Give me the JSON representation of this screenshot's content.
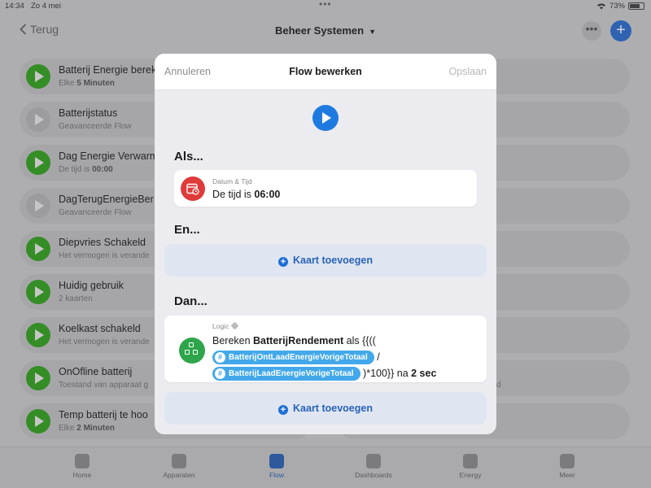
{
  "statusbar": {
    "time": "14:34",
    "date": "Zo 4 mei",
    "battery": "73%"
  },
  "nav": {
    "back_label": "Terug",
    "title": "Beheer Systemen"
  },
  "flows": [
    {
      "title": "Batterij Energie berek",
      "subtitle_pre": "Elke ",
      "subtitle_bold": "5 Minuten",
      "enabled": true
    },
    {
      "title": "Batterijstatus",
      "subtitle_pre": "Geavanceerde Flow",
      "subtitle_bold": "",
      "enabled": false
    },
    {
      "title": "Dag Energie Verwarm",
      "subtitle_pre": "De tijd is ",
      "subtitle_bold": "00:00",
      "enabled": true
    },
    {
      "title": "DagTerugEnergieBer",
      "subtitle_pre": "Geavanceerde Flow",
      "subtitle_bold": "",
      "enabled": false
    },
    {
      "title": "Diepvries Schakeld",
      "subtitle_pre": "Het vermogen is verande",
      "subtitle_bold": "",
      "enabled": true
    },
    {
      "title": "Huidig gebruik",
      "subtitle_pre": "2 kaarten",
      "subtitle_bold": "",
      "enabled": true
    },
    {
      "title": "Koelkast schakeld",
      "subtitle_pre": "Het vermogen is verande",
      "subtitle_bold": "",
      "enabled": true
    },
    {
      "title": "OnOfline batterij",
      "subtitle_pre": "Toestand van apparaat g",
      "subtitle_bold": "",
      "enabled": true
    },
    {
      "title": "Temp  batterij te hoo",
      "subtitle_pre": "Elke ",
      "subtitle_bold": "2 Minuten",
      "enabled": true
    }
  ],
  "right_rows": {
    "row8_fragment": "d"
  },
  "tabs": [
    {
      "label": "Home",
      "icon": "home-icon"
    },
    {
      "label": "Apparaten",
      "icon": "grid-icon"
    },
    {
      "label": "Flow",
      "icon": "shuffle-icon",
      "active": true
    },
    {
      "label": "Dashboards",
      "icon": "dashboard-icon"
    },
    {
      "label": "Energy",
      "icon": "leaf-icon"
    },
    {
      "label": "Meer",
      "icon": "ellipsis-icon"
    }
  ],
  "modal": {
    "cancel": "Annuleren",
    "title": "Flow bewerken",
    "save": "Opslaan",
    "when_heading": "Als...",
    "when_card": {
      "label": "Datum & Tijd",
      "text_pre": "De tijd is ",
      "text_bold": "06:00"
    },
    "and_heading": "En...",
    "add_card": "Kaart toevoegen",
    "then_heading": "Dan...",
    "then_card": {
      "label": "Logic",
      "text_pre": "Bereken ",
      "text_bold": "BatterijRendement",
      "text_mid": " als {{(( ",
      "token1": "BatterijOntLaadEnergieVorigeTotaal",
      "slash": " /",
      "token2": "BatterijLaadEnergieVorigeTotaal",
      "text_post": " )*100}} na ",
      "delay": "2 sec"
    }
  },
  "colors": {
    "accent": "#1f7ae0",
    "play_green": "#34a41f",
    "logic_green": "#2ea54a",
    "date_red": "#e03a3a",
    "token_blue": "#42a8ea"
  }
}
